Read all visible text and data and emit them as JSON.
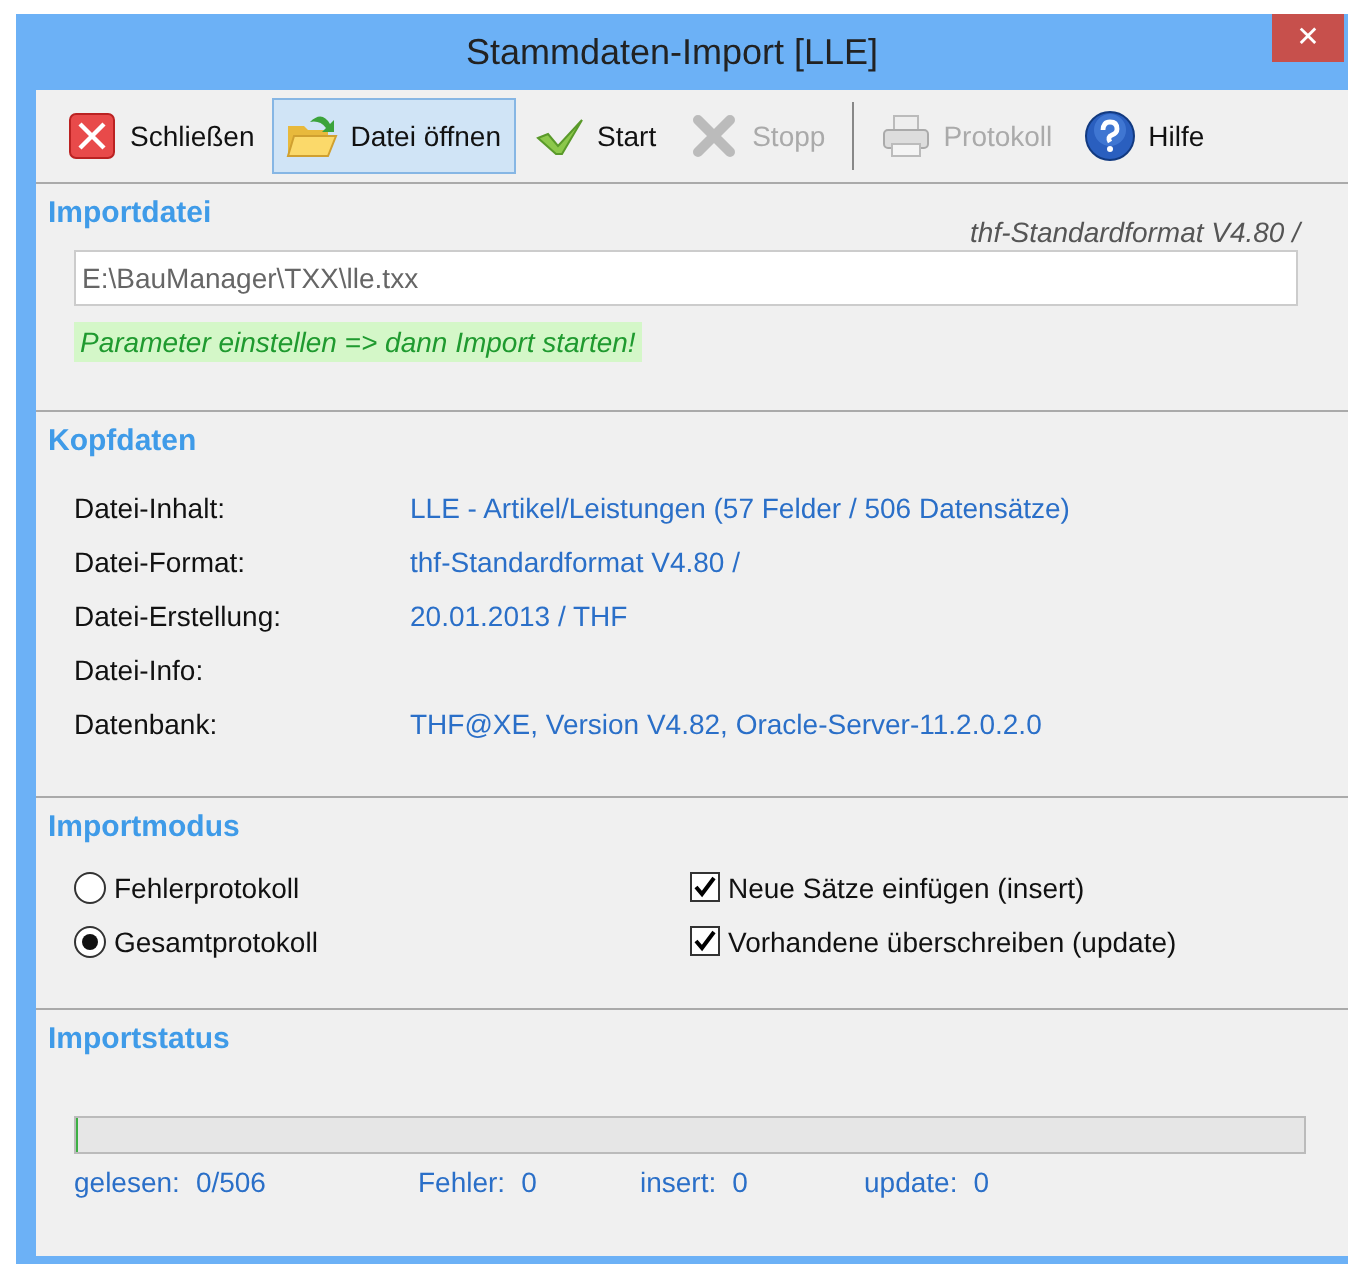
{
  "window": {
    "title": "Stammdaten-Import [LLE]",
    "close": "✕"
  },
  "toolbar": {
    "groups": [
      [
        {
          "label": "Schließen",
          "disabled": false,
          "selected": false
        },
        {
          "label": "Datei öffnen",
          "disabled": false,
          "selected": true
        },
        {
          "label": "Start",
          "disabled": false,
          "selected": false
        },
        {
          "label": "Stopp",
          "disabled": true,
          "selected": false
        }
      ],
      [
        {
          "label": "Protokoll",
          "disabled": true,
          "selected": false
        },
        {
          "label": "Hilfe",
          "disabled": false,
          "selected": false
        }
      ]
    ]
  },
  "importdatei": {
    "heading": "Importdatei",
    "format": "thf-Standardformat V4.80 /",
    "value": "E:\\BauManager\\TXX\\lle.txx",
    "hint": "Parameter einstellen => dann Import starten!"
  },
  "kopfdaten": {
    "heading": "Kopfdaten",
    "rows": [
      {
        "label": "Datei-Inhalt:",
        "value": "LLE - Artikel/Leistungen (57 Felder / 506 Datensätze)"
      },
      {
        "label": "Datei-Format:",
        "value": "thf-Standardformat V4.80 /"
      },
      {
        "label": "Datei-Erstellung:",
        "value": "20.01.2013 / THF"
      },
      {
        "label": "Datei-Info:"
      },
      {
        "label": "Datenbank:",
        "value": "THF@XE, Version V4.82, Oracle-Server-11.2.0.2.0"
      }
    ]
  },
  "importmodus": {
    "heading": "Importmodus",
    "radios": [
      {
        "label": "Fehlerprotokoll",
        "selected": false
      },
      {
        "label": "Gesamtprotokoll",
        "selected": true
      }
    ],
    "checkboxes": [
      {
        "label": "Neue Sätze einfügen (insert)",
        "checked": true
      },
      {
        "label": "Vorhandene überschreiben (update)",
        "checked": true
      }
    ]
  },
  "importstatus": {
    "heading": "Importstatus",
    "progress": {
      "level": 0
    },
    "counters": [
      {
        "label": "gelesen:",
        "value": "0/506"
      },
      {
        "label": "Fehler:",
        "value": "0"
      },
      {
        "label": "insert:",
        "value": "0"
      },
      {
        "label": "update:",
        "value": "0"
      }
    ]
  }
}
